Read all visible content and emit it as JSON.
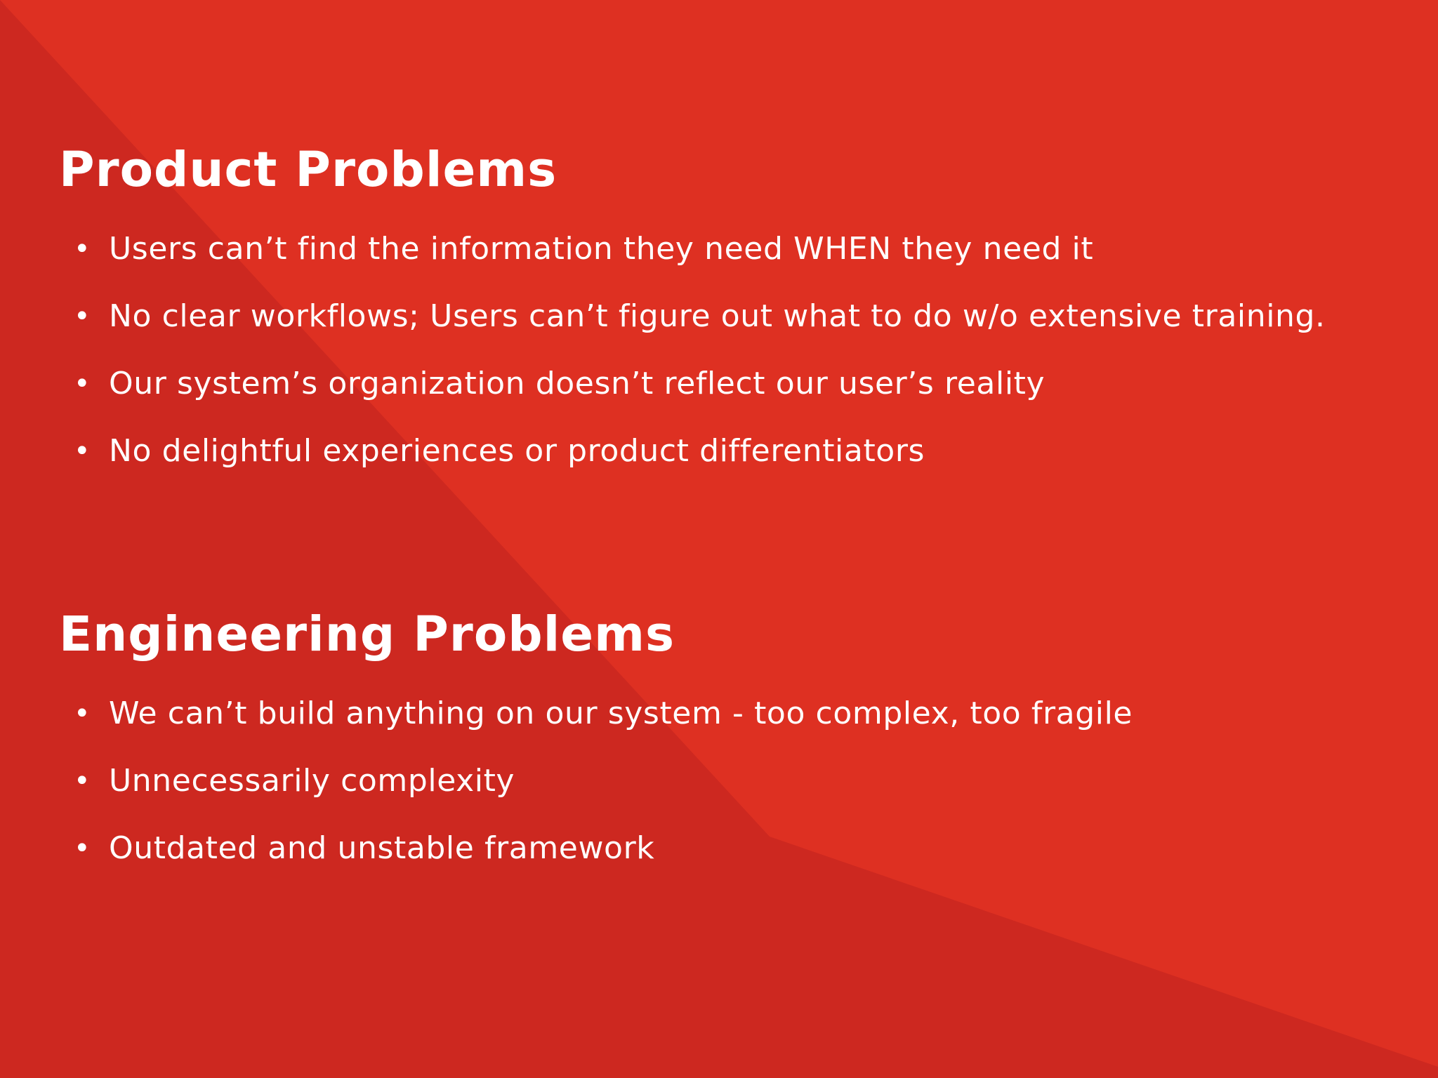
{
  "colors": {
    "background": "#de3022",
    "shadow": "#cd2820",
    "text": "#ffffff"
  },
  "bullet_glyph": "•",
  "product": {
    "heading": "Product Problems",
    "items": [
      "Users can’t find the information they need WHEN they need it",
      "No clear workflows; Users can’t figure out what to do w/o extensive training.",
      "Our system’s organization doesn’t reflect our user’s reality",
      "No delightful experiences or product differentiators"
    ]
  },
  "engineering": {
    "heading": "Engineering Problems",
    "items": [
      "We can’t build anything on our system - too complex, too fragile",
      "Unnecessarily complexity",
      "Outdated and unstable framework"
    ]
  }
}
